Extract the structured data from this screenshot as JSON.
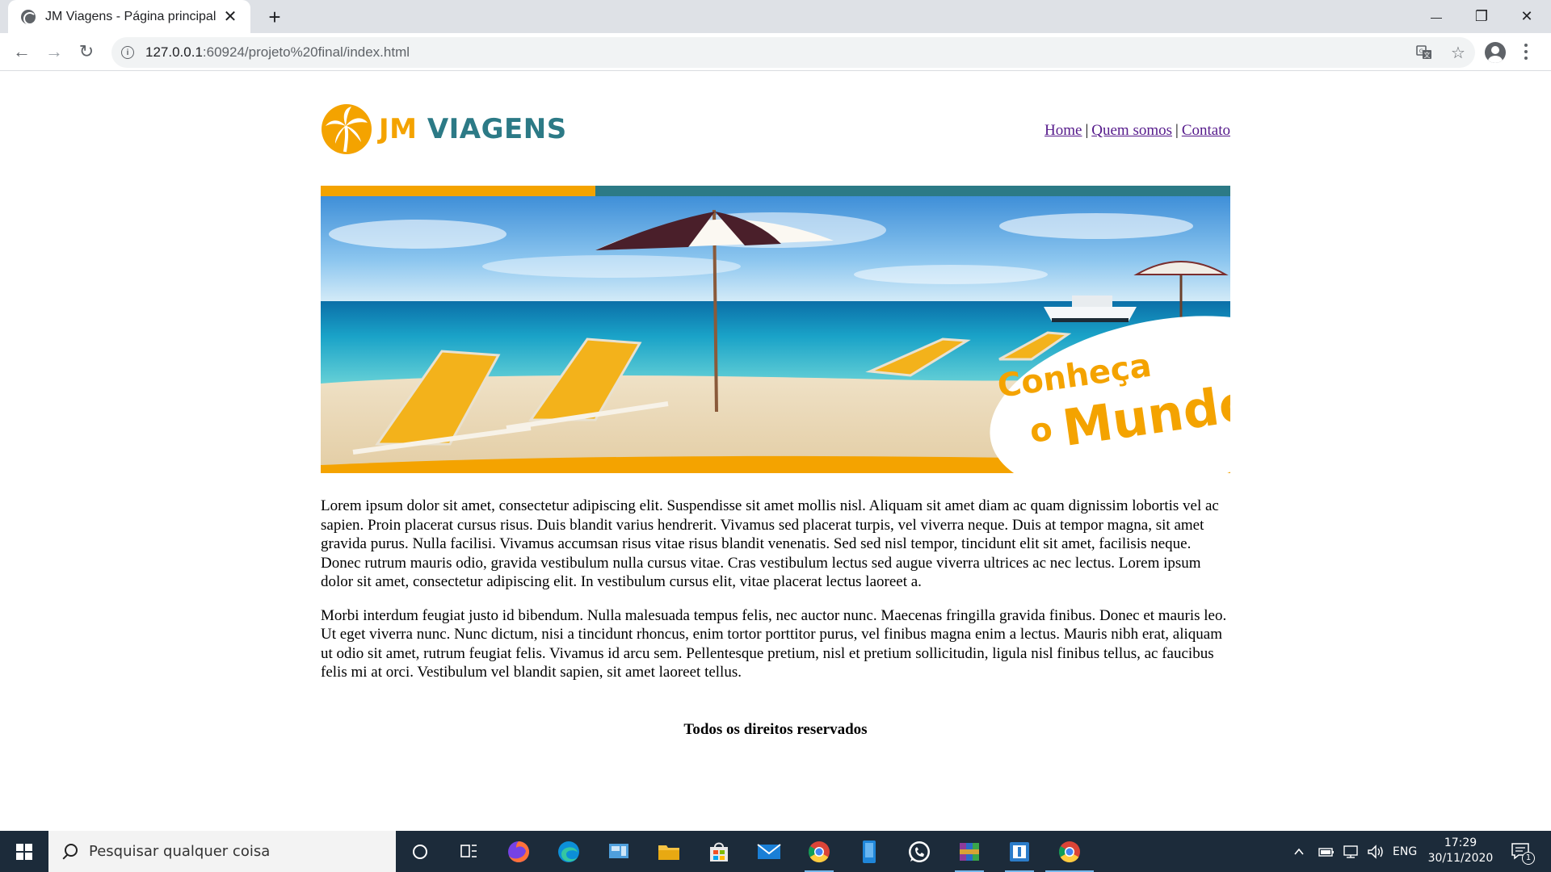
{
  "browser": {
    "tab_title": "JM Viagens - Página principal",
    "url_host": "127.0.0.1",
    "url_rest": ":60924/projeto%20final/index.html",
    "tab_close_glyph": "✕",
    "new_tab_glyph": "+",
    "minimize_glyph": "—",
    "maximize_glyph": "❐",
    "close_glyph": "✕",
    "back_glyph": "←",
    "forward_glyph": "→",
    "reload_glyph": "↻",
    "star_glyph": "☆"
  },
  "site": {
    "logo_jm": "JM",
    "logo_viagens": "VIAGENS",
    "nav": [
      {
        "label": "Home"
      },
      {
        "label": "Quem somos"
      },
      {
        "label": "Contato"
      }
    ],
    "nav_separator": "|",
    "banner_line1": "Conheça",
    "banner_line2_small": "o",
    "banner_line2_big": "Mundo",
    "paragraphs": [
      "Lorem ipsum dolor sit amet, consectetur adipiscing elit. Suspendisse sit amet mollis nisl. Aliquam sit amet diam ac quam dignissim lobortis vel ac sapien. Proin placerat cursus risus. Duis blandit varius hendrerit. Vivamus sed placerat turpis, vel viverra neque. Duis at tempor magna, sit amet gravida purus. Nulla facilisi. Vivamus accumsan risus vitae risus blandit venenatis. Sed sed nisl tempor, tincidunt elit sit amet, facilisis neque. Donec rutrum mauris odio, gravida vestibulum nulla cursus vitae. Cras vestibulum lectus sed augue viverra ultrices ac nec lectus. Lorem ipsum dolor sit amet, consectetur adipiscing elit. In vestibulum cursus elit, vitae placerat lectus laoreet a.",
      "Morbi interdum feugiat justo id bibendum. Nulla malesuada tempus felis, nec auctor nunc. Maecenas fringilla gravida finibus. Donec et mauris leo. Ut eget viverra nunc. Nunc dictum, nisi a tincidunt rhoncus, enim tortor porttitor purus, vel finibus magna enim a lectus. Mauris nibh erat, aliquam ut odio sit amet, rutrum feugiat felis. Vivamus id arcu sem. Pellentesque pretium, nisl et pretium sollicitudin, ligula nisl finibus tellus, ac faucibus felis mi at orci. Vestibulum vel blandit sapien, sit amet laoreet tellus."
    ],
    "footer": "Todos os direitos reservados"
  },
  "taskbar": {
    "search_placeholder": "Pesquisar qualquer coisa",
    "language": "ENG",
    "time": "17:29",
    "date": "30/11/2020",
    "notification_count": "1"
  },
  "colors": {
    "brand_orange": "#f4a300",
    "brand_teal": "#2c7a86",
    "link_visited": "#551a8b",
    "taskbar_bg": "#1c2b3a"
  }
}
